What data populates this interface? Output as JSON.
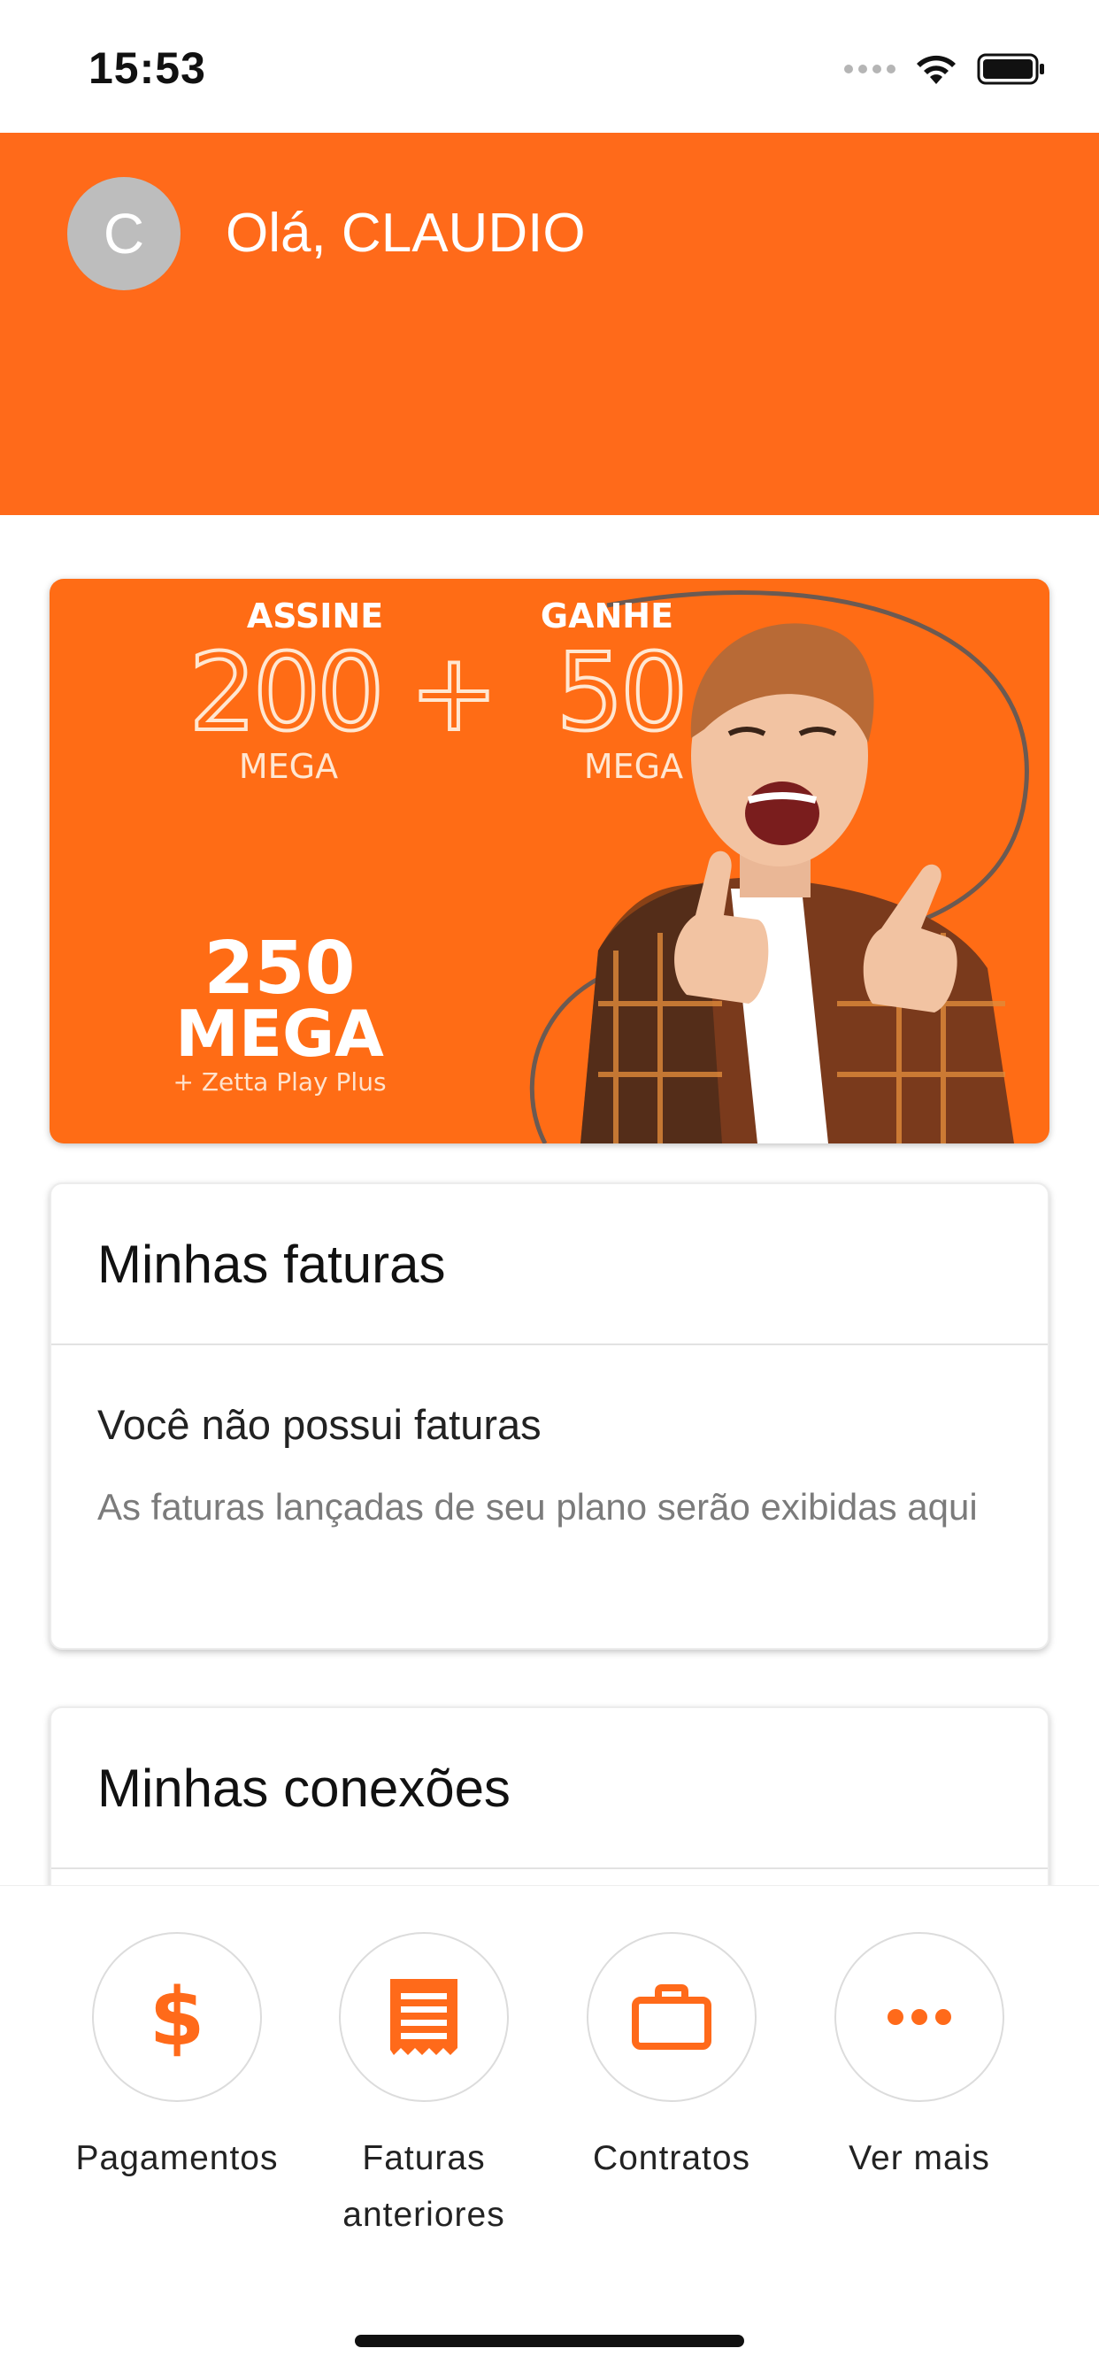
{
  "status_bar": {
    "time": "15:53"
  },
  "header": {
    "avatar_initial": "C",
    "greeting": "Olá, CLAUDIO",
    "background_color": "#ff6a1a"
  },
  "banner": {
    "assine": "ASSINE",
    "ganhe": "GANHE",
    "value_a": "200",
    "plus": "+",
    "value_b": "50",
    "unit_a": "MEGA",
    "unit_b": "MEGA",
    "total": "250",
    "total_unit": "MEGA",
    "addon": "+ Zetta Play Plus"
  },
  "invoices_card": {
    "title": "Minhas faturas",
    "empty_title": "Você não possui faturas",
    "empty_description": "As faturas lançadas de seu plano serão exibidas aqui"
  },
  "connections_card": {
    "title": "Minhas conexões"
  },
  "bottom_nav": {
    "items": [
      {
        "label": "Pagamentos",
        "icon": "dollar-icon"
      },
      {
        "label": "Faturas anteriores",
        "icon": "receipt-icon"
      },
      {
        "label": "Contratos",
        "icon": "briefcase-icon"
      },
      {
        "label": "Ver mais",
        "icon": "more-icon"
      }
    ],
    "accent_color": "#ff6a1a"
  }
}
